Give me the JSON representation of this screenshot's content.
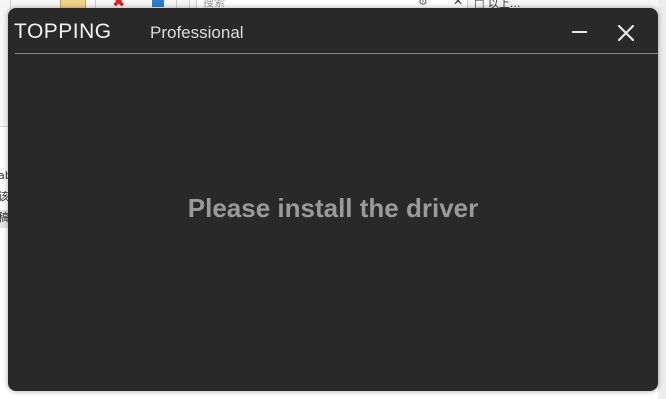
{
  "background_app": {
    "search_placeholder": "搜索",
    "right_text": "□ 以上...",
    "left_texts": [
      "ab",
      "该",
      "稿"
    ]
  },
  "window": {
    "brand": "TOPPING",
    "brand_suffix": "Professional",
    "message": "Please install the driver",
    "icons": {
      "minimize": "minimize-icon",
      "close": "close-icon"
    },
    "colors": {
      "window_bg": "#292929",
      "message": "#9a9a9a",
      "brand": "#f2f2f2"
    }
  }
}
